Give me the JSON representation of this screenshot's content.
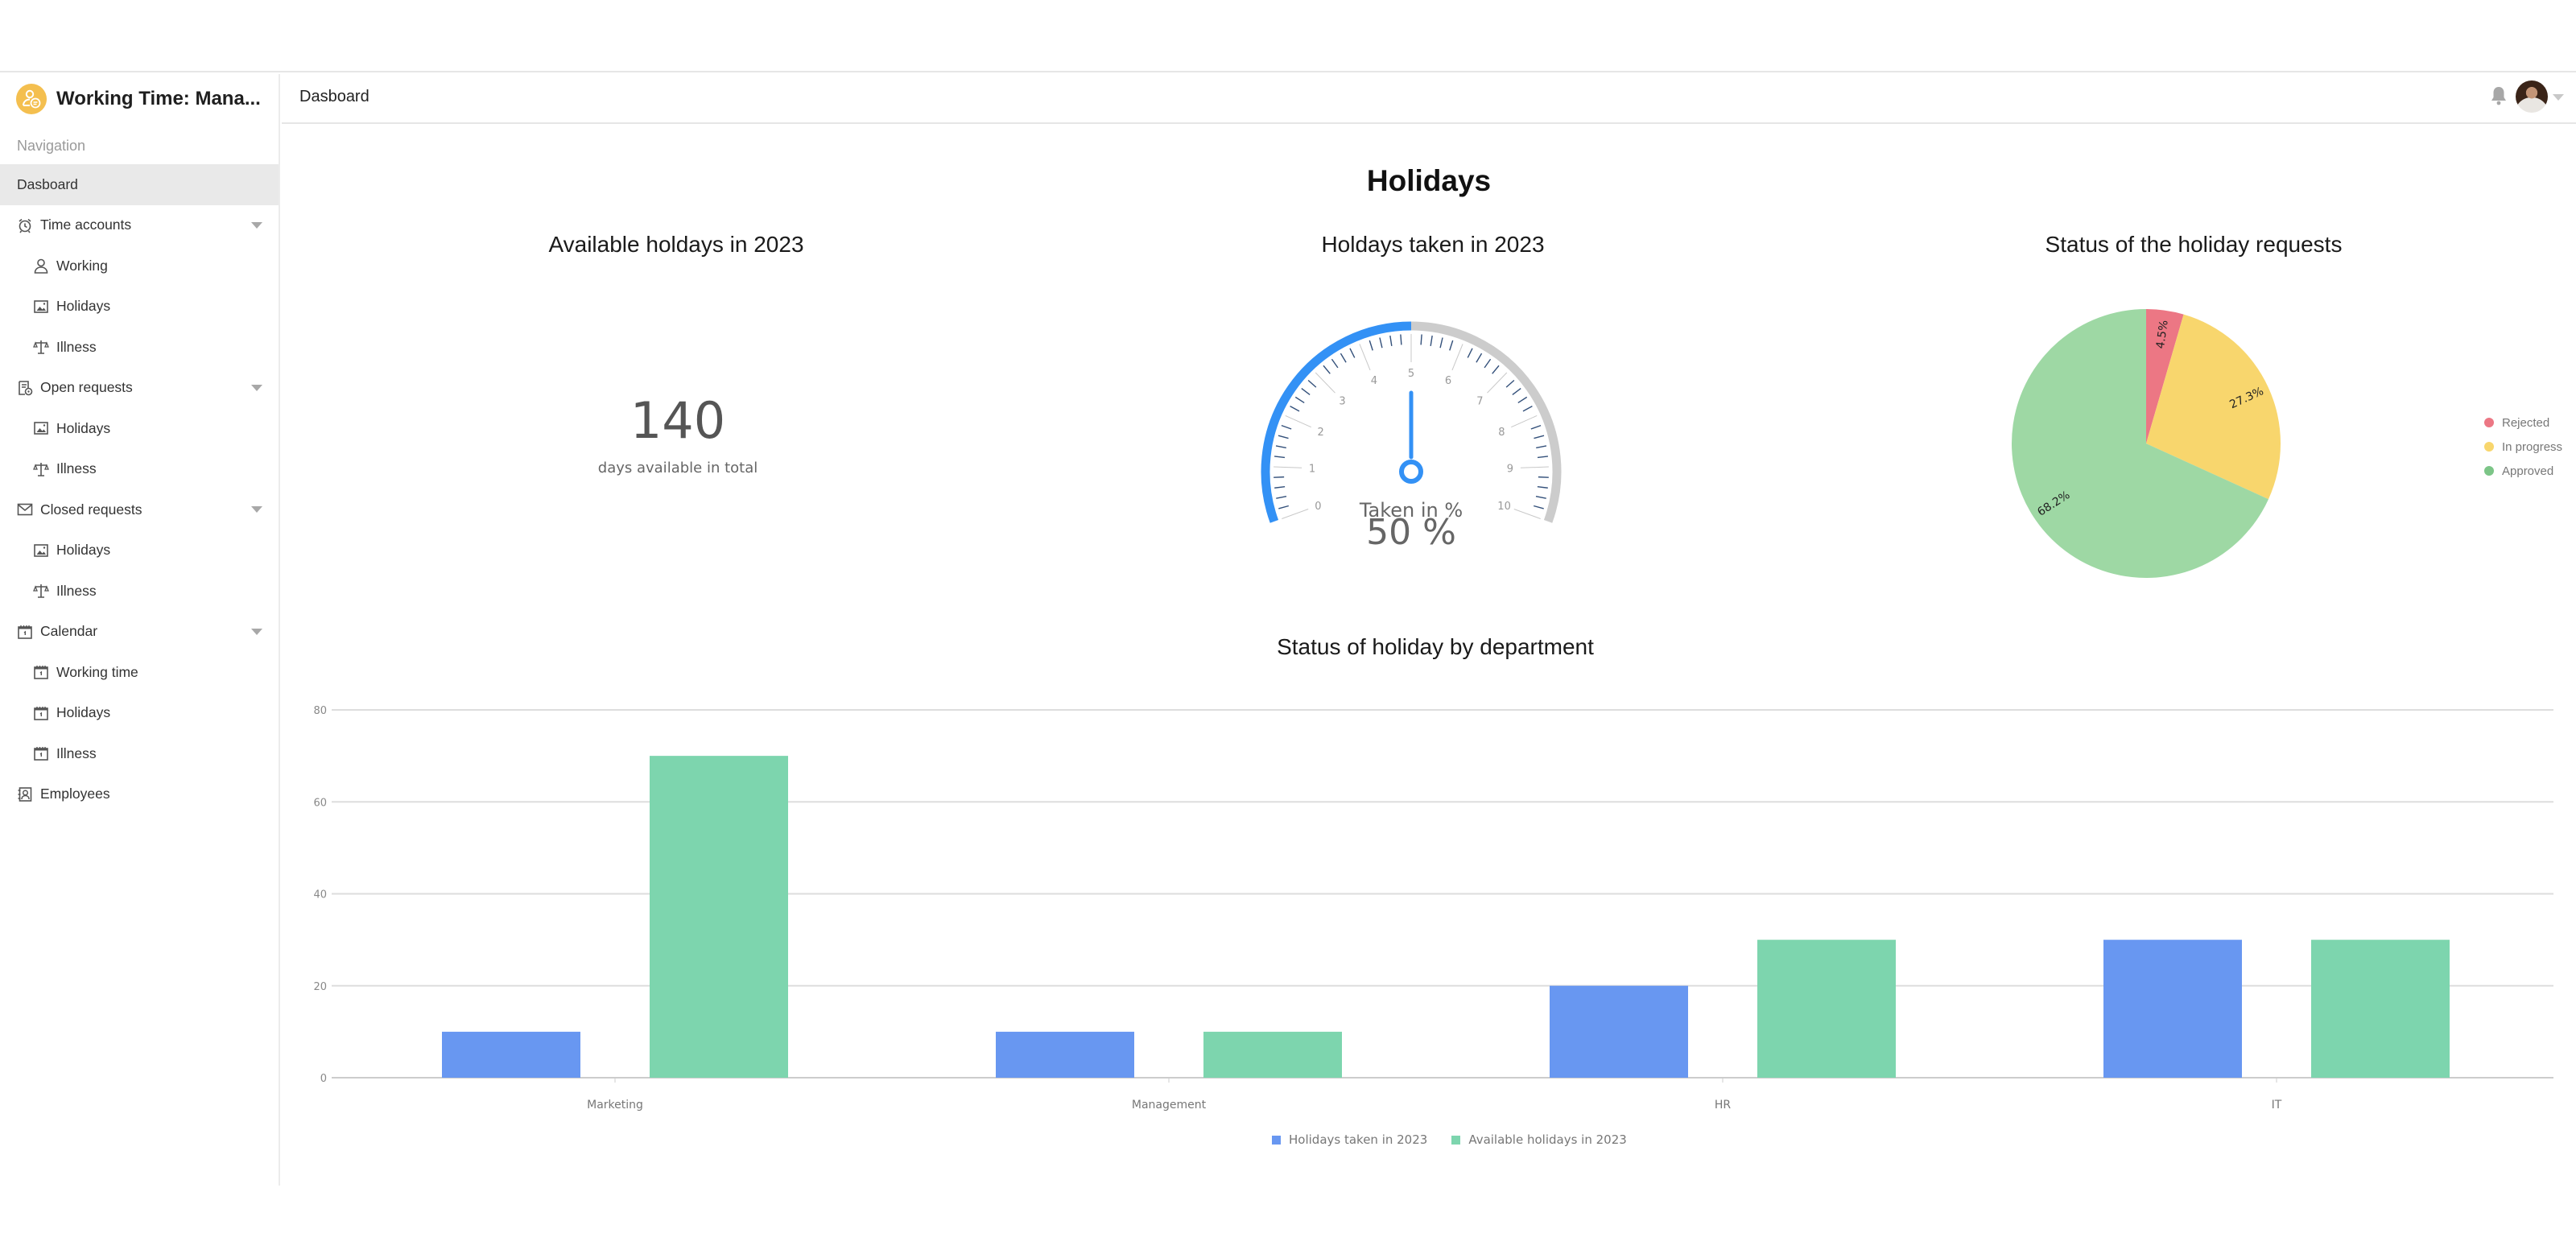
{
  "app": {
    "title": "Working Time: Mana...",
    "logo_icon": "user-chat-icon"
  },
  "sidebar": {
    "caption": "Navigation",
    "items": [
      {
        "label": "Dasboard",
        "level": 0,
        "active": true
      },
      {
        "label": "Time accounts",
        "level": 0,
        "icon": "alarm-clock-icon",
        "expandable": true
      },
      {
        "label": "Working",
        "level": 1,
        "icon": "user-icon"
      },
      {
        "label": "Holidays",
        "level": 1,
        "icon": "image-icon"
      },
      {
        "label": "Illness",
        "level": 1,
        "icon": "scale-icon"
      },
      {
        "label": "Open requests",
        "level": 0,
        "icon": "document-clock-icon",
        "expandable": true
      },
      {
        "label": "Holidays",
        "level": 1,
        "icon": "image-icon"
      },
      {
        "label": "Illness",
        "level": 1,
        "icon": "scale-icon"
      },
      {
        "label": "Closed requests",
        "level": 0,
        "icon": "envelope-icon",
        "expandable": true
      },
      {
        "label": "Holidays",
        "level": 1,
        "icon": "image-icon"
      },
      {
        "label": "Illness",
        "level": 1,
        "icon": "scale-icon"
      },
      {
        "label": "Calendar",
        "level": 0,
        "icon": "calendar-icon",
        "expandable": true
      },
      {
        "label": "Working time",
        "level": 1,
        "icon": "calendar-icon"
      },
      {
        "label": "Holidays",
        "level": 1,
        "icon": "calendar-icon"
      },
      {
        "label": "Illness",
        "level": 1,
        "icon": "calendar-icon"
      },
      {
        "label": "Employees",
        "level": 0,
        "icon": "contacts-icon"
      }
    ]
  },
  "header": {
    "title": "Dasboard",
    "notification_icon": "bell-icon",
    "user_menu_icon": "chevron-down-icon"
  },
  "page": {
    "title": "Holidays"
  },
  "kpi": {
    "title": "Available holdays in 2023",
    "value": "140",
    "caption": "days available in total"
  },
  "colors": {
    "gauge_fill": "#3391f5",
    "gauge_track": "#cccccc",
    "rejected": "#ec7784",
    "in_progress": "#f8d66d",
    "approved": "#9ed8a4",
    "approved_legend": "#7cc587",
    "bar_taken": "#6897f1",
    "bar_available": "#7dd5ae"
  },
  "chart_data": [
    {
      "type": "gauge",
      "title": "Holdays taken in 2023",
      "label": "Taken in %",
      "value_text": "50 %",
      "value": 5,
      "range": [
        0,
        10
      ],
      "tick_labels": [
        "0",
        "1",
        "2",
        "3",
        "4",
        "5",
        "6",
        "7",
        "8",
        "9",
        "10"
      ]
    },
    {
      "type": "pie",
      "title": "Status of the holiday requests",
      "slices": [
        {
          "name": "Rejected",
          "value": 4.5,
          "label": "4.5%"
        },
        {
          "name": "In progress",
          "value": 27.3,
          "label": "27.3%"
        },
        {
          "name": "Approved",
          "value": 68.2,
          "label": "68.2%"
        }
      ],
      "legend": [
        "Rejected",
        "In progress",
        "Approved"
      ],
      "legend_position": "right"
    },
    {
      "type": "bar",
      "title": "Status of holiday by department",
      "categories": [
        "Marketing",
        "Management",
        "HR",
        "IT"
      ],
      "series": [
        {
          "name": "Holidays taken in 2023",
          "values": [
            10,
            10,
            20,
            30
          ]
        },
        {
          "name": "Available holidays in 2023",
          "values": [
            70,
            10,
            30,
            30
          ]
        }
      ],
      "yticks": [
        "0",
        "20",
        "40",
        "60",
        "80"
      ],
      "ylim": [
        0,
        80
      ],
      "grid": true,
      "legend_position": "bottom"
    }
  ]
}
